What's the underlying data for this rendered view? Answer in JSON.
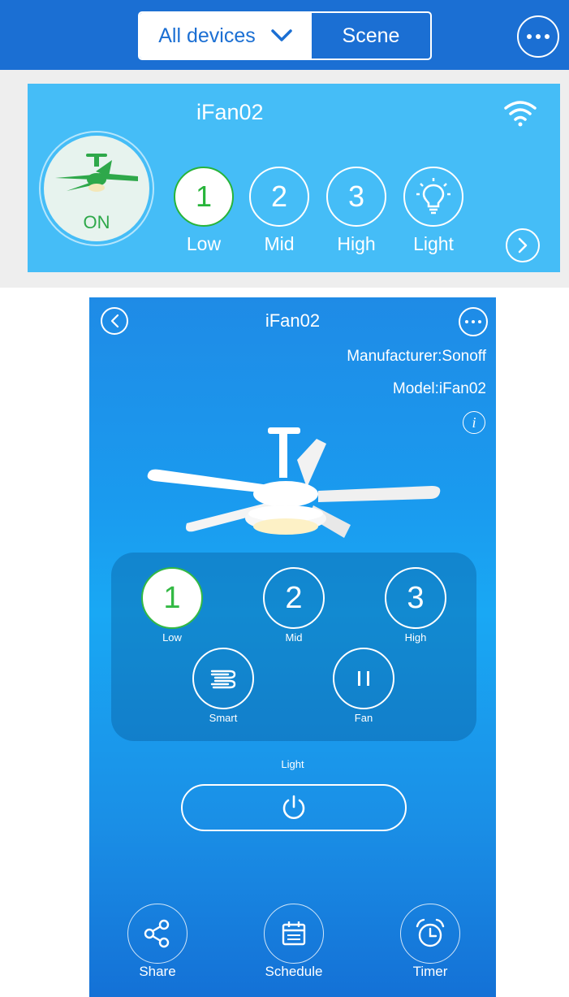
{
  "top": {
    "tabs": {
      "all_devices": "All devices",
      "scene": "Scene"
    },
    "card": {
      "title": "iFan02",
      "power_label": "ON",
      "speeds": [
        {
          "number": "1",
          "label": "Low",
          "active": true
        },
        {
          "number": "2",
          "label": "Mid",
          "active": false
        },
        {
          "number": "3",
          "label": "High",
          "active": false
        }
      ],
      "light_label": "Light"
    }
  },
  "device": {
    "title": "iFan02",
    "manufacturer": "Manufacturer:Sonoff",
    "model": "Model:iFan02",
    "info_icon": "i",
    "speeds": [
      {
        "number": "1",
        "label": "Low",
        "active": true
      },
      {
        "number": "2",
        "label": "Mid",
        "active": false
      },
      {
        "number": "3",
        "label": "High",
        "active": false
      }
    ],
    "modes": [
      {
        "label": "Smart",
        "icon": "wind-icon"
      },
      {
        "label": "Fan",
        "icon": "pause-icon"
      }
    ],
    "light_label": "Light",
    "bottom": [
      {
        "label": "Share",
        "icon": "share-icon"
      },
      {
        "label": "Schedule",
        "icon": "calendar-icon"
      },
      {
        "label": "Timer",
        "icon": "alarm-clock-icon"
      }
    ]
  },
  "colors": {
    "header_blue": "#1b6fd3",
    "card_blue": "#45bdf7",
    "active_green": "#27b43a"
  }
}
